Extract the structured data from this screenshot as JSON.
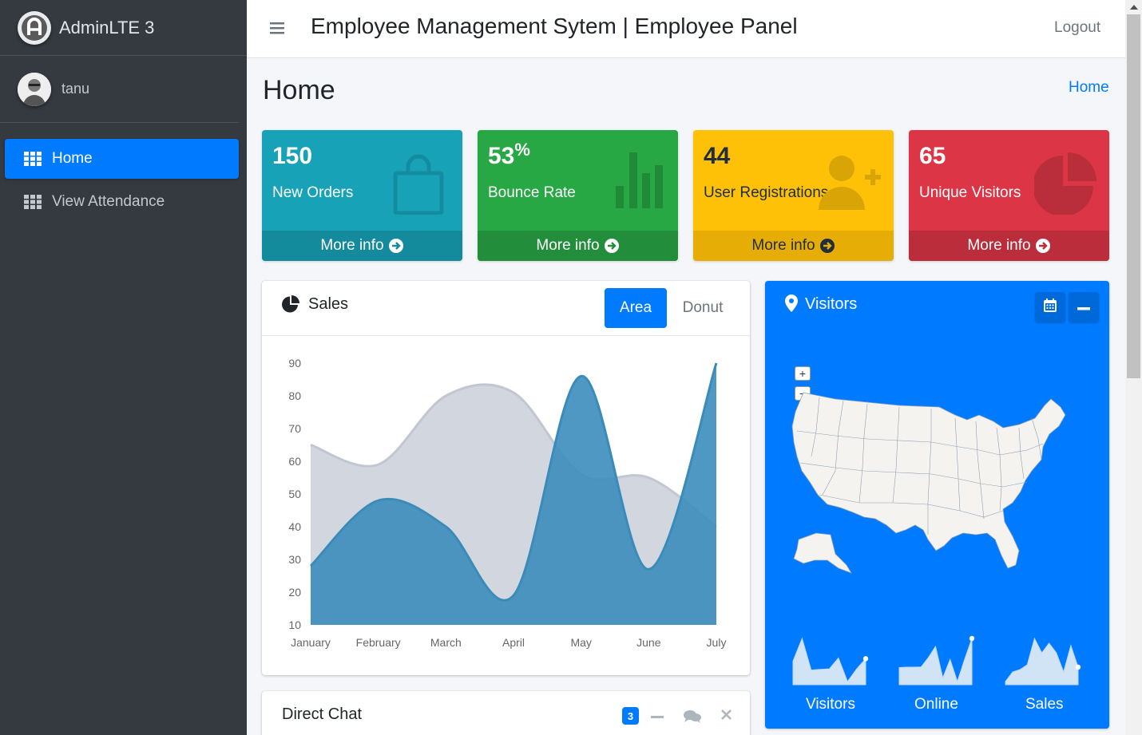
{
  "brand": {
    "name": "AdminLTE 3"
  },
  "user": {
    "name": "tanu"
  },
  "sidebar": {
    "items": [
      {
        "label": "Home",
        "icon": "th-icon",
        "active": true
      },
      {
        "label": "View Attendance",
        "icon": "th-icon",
        "active": false
      }
    ]
  },
  "header": {
    "title": "Employee Management Sytem | Employee Panel",
    "logout_label": "Logout"
  },
  "page": {
    "title": "Home",
    "breadcrumb": "Home"
  },
  "boxes": [
    {
      "value": "150",
      "label": "New Orders",
      "footer": "More info",
      "color": "#17a2b8",
      "icon": "shopping-bag-icon"
    },
    {
      "value": "53",
      "suffix": "%",
      "label": "Bounce Rate",
      "footer": "More info",
      "color": "#28a745",
      "icon": "bar-chart-icon"
    },
    {
      "value": "44",
      "label": "User Registrations",
      "footer": "More info",
      "color": "#ffc107",
      "icon": "user-plus-icon"
    },
    {
      "value": "65",
      "label": "Unique Visitors",
      "footer": "More info",
      "color": "#dc3545",
      "icon": "pie-chart-icon"
    }
  ],
  "sales": {
    "title": "Sales",
    "tabs": [
      "Area",
      "Donut"
    ],
    "active_tab": "Area"
  },
  "chart_data": {
    "type": "area",
    "categories": [
      "January",
      "February",
      "March",
      "April",
      "May",
      "June",
      "July"
    ],
    "ylim": [
      10,
      90
    ],
    "yticks": [
      "90",
      "80",
      "70",
      "60",
      "50",
      "40",
      "30",
      "20",
      "10"
    ],
    "series": [
      {
        "values": [
          65,
          59,
          80,
          81,
          56,
          55,
          40
        ],
        "color": "#d2d6de"
      },
      {
        "values": [
          28,
          48,
          40,
          19,
          86,
          27,
          90
        ],
        "color": "#3c8dbc"
      }
    ],
    "grid": false,
    "legend": "none"
  },
  "visitors": {
    "title": "Visitors",
    "zoom_in": "+",
    "zoom_out": "−",
    "sparklines": [
      {
        "label": "Visitors",
        "values": [
          1000,
          1200,
          920,
          927,
          931,
          1027,
          819,
          930,
          1021
        ]
      },
      {
        "label": "Online",
        "values": [
          515,
          519,
          520,
          522,
          652,
          810,
          370,
          627,
          319,
          630,
          921
        ]
      },
      {
        "label": "Sales",
        "values": [
          15,
          19,
          20,
          22,
          33,
          27,
          31,
          27,
          19,
          30,
          21
        ]
      }
    ]
  },
  "chat": {
    "title": "Direct Chat",
    "badge": "3"
  },
  "colors": {
    "sidebar": "#343a40",
    "primary": "#007bff",
    "content_bg": "#f4f6f9"
  }
}
